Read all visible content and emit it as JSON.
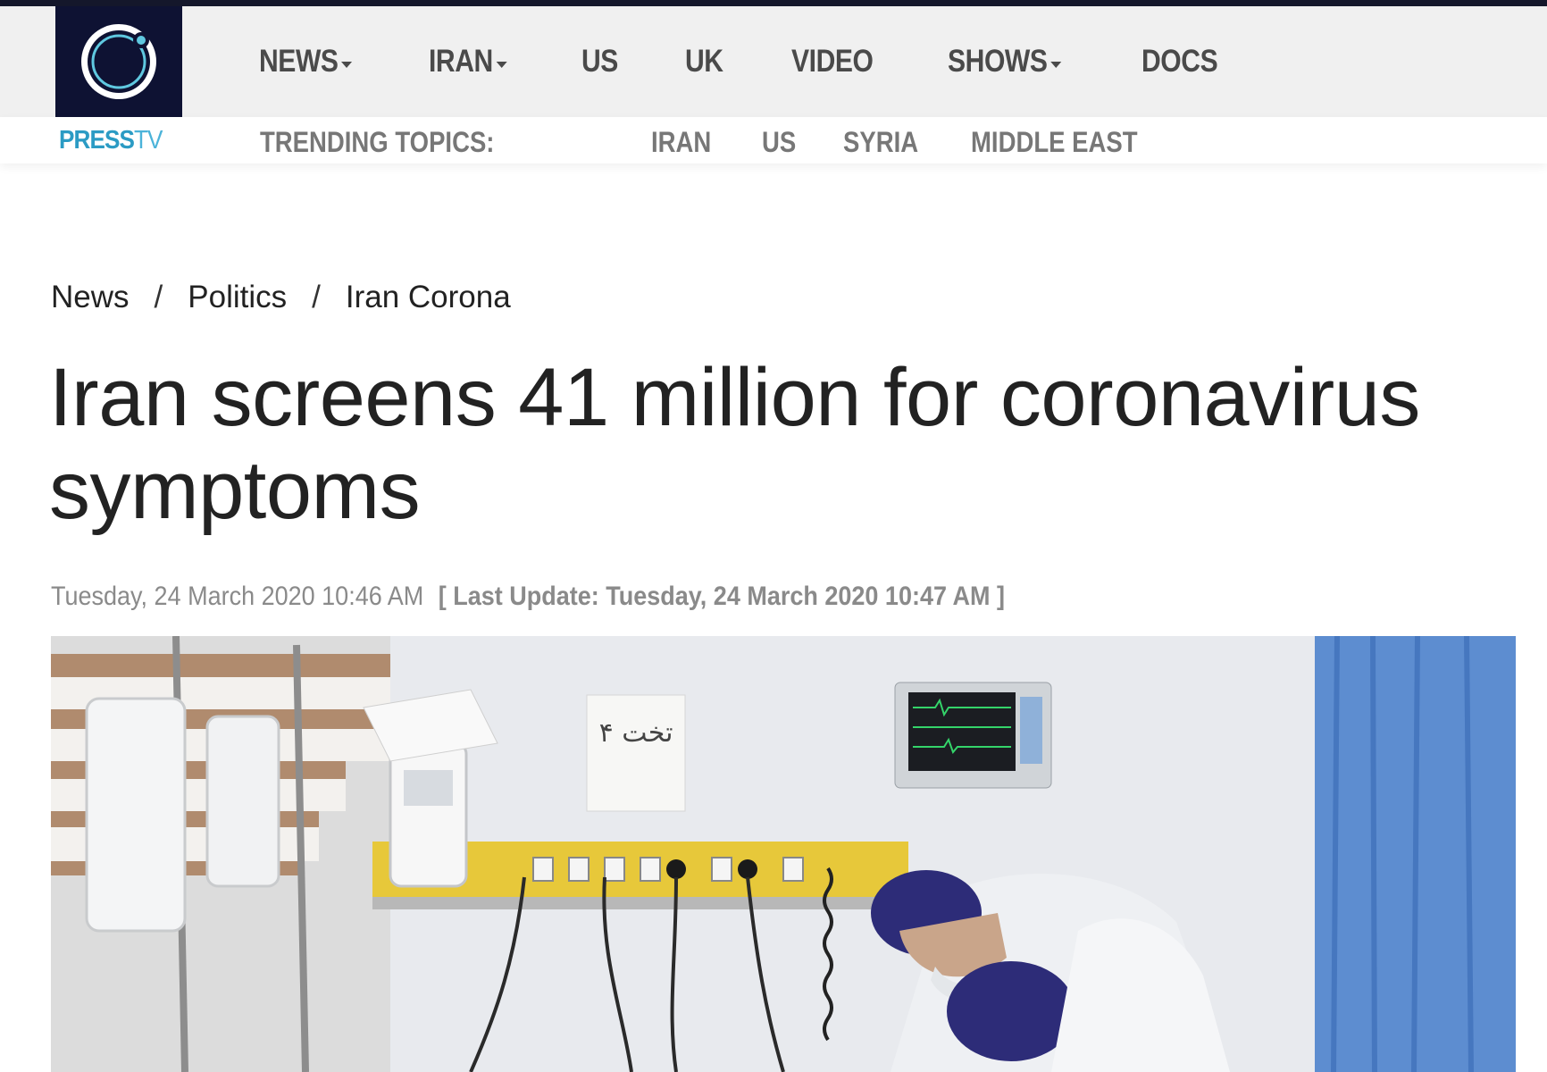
{
  "header": {
    "nav_items": [
      {
        "label": "NEWS",
        "has_dropdown": true
      },
      {
        "label": "IRAN",
        "has_dropdown": true
      },
      {
        "label": "US",
        "has_dropdown": false
      },
      {
        "label": "UK",
        "has_dropdown": false
      },
      {
        "label": "VIDEO",
        "has_dropdown": false
      },
      {
        "label": "SHOWS",
        "has_dropdown": true
      },
      {
        "label": "DOCS",
        "has_dropdown": false
      }
    ],
    "brand": {
      "press": "PRESS",
      "tv": "TV"
    },
    "trending_label": "TRENDING TOPICS:",
    "trending_items": [
      "IRAN",
      "US",
      "SYRIA",
      "MIDDLE EAST"
    ],
    "colors": {
      "logo_bg": "#0e1233",
      "brand": "#2b9bc4",
      "nav_bg": "#f0f0f0"
    }
  },
  "article": {
    "breadcrumb": [
      "News",
      "Politics",
      "Iran Corona"
    ],
    "breadcrumb_separator": "/",
    "title": "Iran screens 41 million for coronavirus symptoms",
    "published": "Tuesday, 24 March 2020 10:46 AM",
    "last_update": "[ Last Update: Tuesday, 24 March 2020 10:47 AM ]",
    "image_sign_text": "تخت ۴"
  }
}
